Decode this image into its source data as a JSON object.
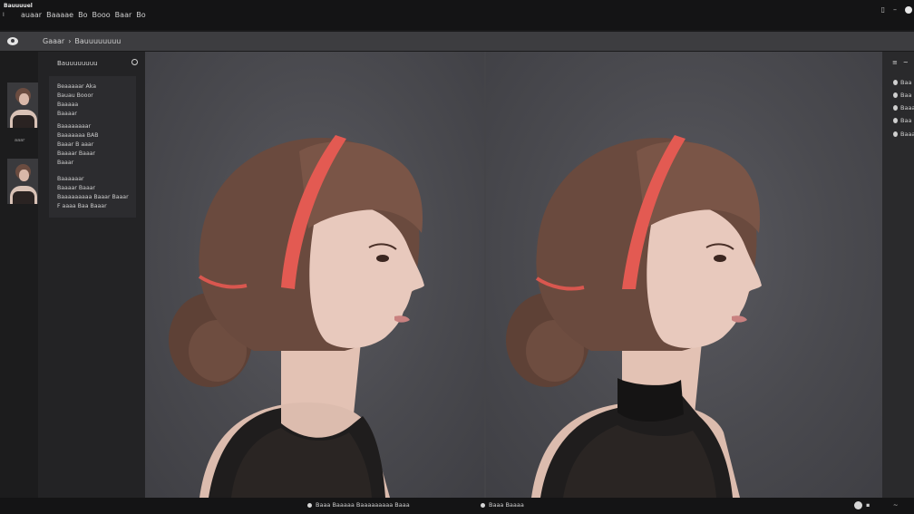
{
  "app": {
    "name": "Bauuuuel",
    "name_sub": "I"
  },
  "menu": [
    "auaar",
    "Baaaae",
    "Bo",
    "Booo",
    "Baar",
    "Bo"
  ],
  "window_controls": {
    "restore": "▯",
    "minimize": "–"
  },
  "tabs": {
    "breadcrumb_root": "Gaaar",
    "breadcrumb_separator": "›",
    "breadcrumb_current": "Bauuuuuuuu"
  },
  "thumbnails": [
    {
      "caption": "aaar"
    },
    {
      "caption": ""
    }
  ],
  "info_panel": {
    "title": "Bauuuuuuuu",
    "lines": [
      "Beaaaaar Aka",
      "Bauau Booor",
      "Baaaaa",
      "Baaaar",
      "Baaaaaaaar",
      "Baaaaaaa BAB",
      "Baaar B aaar",
      "Baaaar Baaar",
      "Baaar",
      "Baaaaaar",
      "Baaaar Baaar",
      "Baaaaaaaaa Baaar Baaar",
      "F aaaa Baa Baaar"
    ]
  },
  "right_panel": {
    "header_a": "≡",
    "header_b": "~",
    "items": [
      "Baa",
      "Baa",
      "Baaa",
      "Baa",
      "Baaa"
    ]
  },
  "bottom_bar": {
    "left_text": "Baaa Baaaaa Baaaaaaaaa Baaa",
    "mid_text": "Baaa Baaaa",
    "right_a": "▪",
    "right_b": "~"
  },
  "colors": {
    "headband": "#e35a52",
    "hair": "#6a4a3e",
    "skin": "#e8c9bd",
    "top": "#1f1d1d",
    "canvas_bg": "#4b4b50"
  }
}
